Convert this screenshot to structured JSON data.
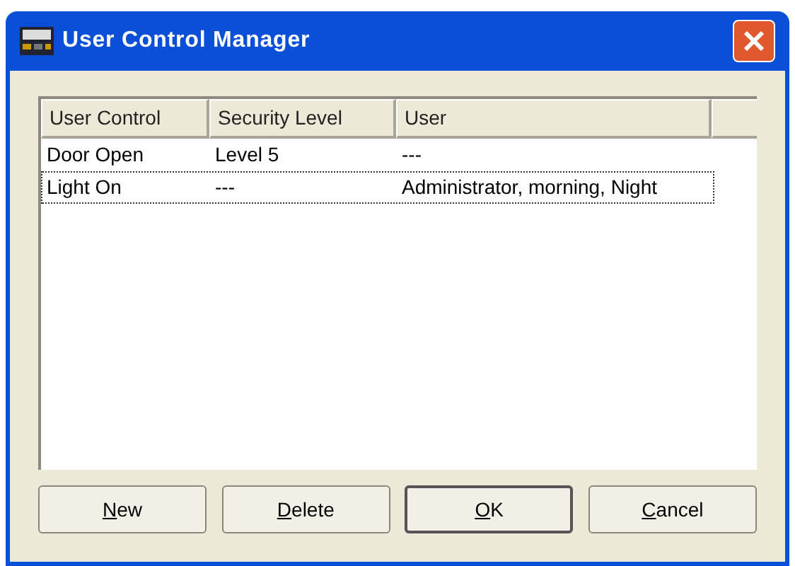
{
  "window": {
    "title": "User Control Manager"
  },
  "table": {
    "columns": [
      "User Control",
      "Security Level",
      "User"
    ],
    "rows": [
      {
        "cells": [
          "Door Open",
          "Level 5",
          "---"
        ],
        "focused": false
      },
      {
        "cells": [
          "Light On",
          "---",
          "Administrator, morning, Night"
        ],
        "focused": true
      }
    ]
  },
  "buttons": [
    {
      "label": "New",
      "default": false
    },
    {
      "label": "Delete",
      "default": false
    },
    {
      "label": "OK",
      "default": true
    },
    {
      "label": "Cancel",
      "default": false
    }
  ]
}
